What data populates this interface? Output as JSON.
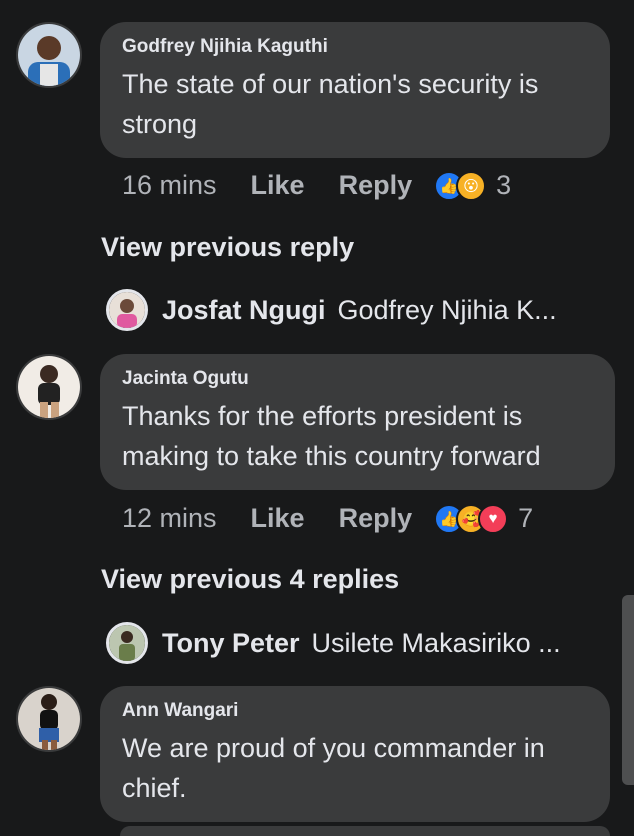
{
  "comments": [
    {
      "author": "Godfrey Njihia Kaguthi",
      "text": "The state of our nation's security is strong",
      "time": "16 mins",
      "like_label": "Like",
      "reply_label": "Reply",
      "reaction_count": "3",
      "reactions": [
        "like",
        "wow"
      ],
      "view_previous": "View previous reply",
      "reply_preview": {
        "name": "Josfat Ngugi",
        "text": "Godfrey Njihia K..."
      }
    },
    {
      "author": "Jacinta Ogutu",
      "text": "Thanks for the efforts president is making to take this country forward",
      "time": "12 mins",
      "like_label": "Like",
      "reply_label": "Reply",
      "reaction_count": "7",
      "reactions": [
        "like",
        "care",
        "love"
      ],
      "view_previous": "View previous 4 replies",
      "reply_preview": {
        "name": "Tony Peter",
        "text": "Usilete Makasiriko ..."
      }
    },
    {
      "author": "Ann Wangari",
      "text": "We are proud of you commander in chief."
    }
  ],
  "colors": {
    "background": "#18191a",
    "bubble": "#3a3b3c",
    "like": "#2078f4",
    "love": "#f33e58",
    "wow": "#f7b125"
  }
}
